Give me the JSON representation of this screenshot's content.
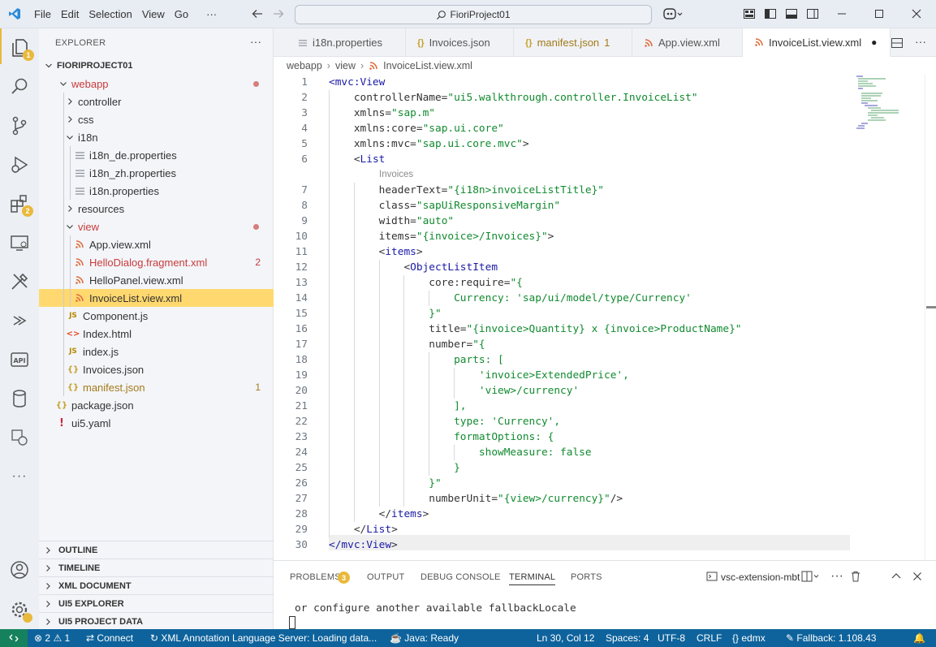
{
  "menu": [
    "File",
    "Edit",
    "Selection",
    "View",
    "Go",
    "···"
  ],
  "title": "FioriProject01",
  "explorer": {
    "header": "EXPLORER",
    "more": "···",
    "project": "FIORIPROJECT01",
    "tree": [
      {
        "label": "webapp",
        "type": "folder-open",
        "depth": 0,
        "style": "modified",
        "dot": true
      },
      {
        "label": "controller",
        "type": "folder",
        "depth": 1
      },
      {
        "label": "css",
        "type": "folder",
        "depth": 1
      },
      {
        "label": "i18n",
        "type": "folder-open",
        "depth": 1
      },
      {
        "label": "i18n_de.properties",
        "type": "settings",
        "depth": 2
      },
      {
        "label": "i18n_zh.properties",
        "type": "settings",
        "depth": 2
      },
      {
        "label": "i18n.properties",
        "type": "settings",
        "depth": 2
      },
      {
        "label": "resources",
        "type": "folder",
        "depth": 1
      },
      {
        "label": "view",
        "type": "folder-open",
        "depth": 1,
        "style": "modified",
        "dot": true
      },
      {
        "label": "App.view.xml",
        "type": "xml",
        "depth": 2
      },
      {
        "label": "HelloDialog.fragment.xml",
        "type": "xml",
        "depth": 2,
        "style": "error",
        "deco": "2"
      },
      {
        "label": "HelloPanel.view.xml",
        "type": "xml",
        "depth": 2
      },
      {
        "label": "InvoiceList.view.xml",
        "type": "xml",
        "depth": 2,
        "selected": true
      },
      {
        "label": "Component.js",
        "type": "js",
        "depth": 1
      },
      {
        "label": "Index.html",
        "type": "html",
        "depth": 1
      },
      {
        "label": "index.js",
        "type": "js",
        "depth": 1
      },
      {
        "label": "Invoices.json",
        "type": "json",
        "depth": 1
      },
      {
        "label": "manifest.json",
        "type": "json",
        "depth": 1,
        "style": "warn",
        "deco": "1"
      },
      {
        "label": "package.json",
        "type": "json",
        "depth": 0
      },
      {
        "label": "ui5.yaml",
        "type": "yaml",
        "depth": 0
      }
    ],
    "sections": [
      "OUTLINE",
      "TIMELINE",
      "XML DOCUMENT",
      "UI5 EXPLORER",
      "UI5 PROJECT DATA"
    ]
  },
  "activity_badges": {
    "explorer": "1",
    "extensions": "2"
  },
  "tabs": [
    {
      "label": "i18n.properties",
      "icon": "settings"
    },
    {
      "label": "Invoices.json",
      "icon": "json"
    },
    {
      "label": "manifest.json",
      "icon": "json",
      "deco": "1",
      "warn": true
    },
    {
      "label": "App.view.xml",
      "icon": "xml"
    },
    {
      "label": "InvoiceList.view.xml",
      "icon": "xml",
      "active": true,
      "dirty": "●"
    }
  ],
  "breadcrumb": [
    "webapp",
    "view",
    "InvoiceList.view.xml"
  ],
  "code": {
    "lines": [
      [
        [
          "tg",
          "<mvc:View"
        ]
      ],
      [
        [
          "at",
          "    controllerName="
        ],
        [
          "st",
          "\"ui5.walkthrough.controller.InvoiceList\""
        ]
      ],
      [
        [
          "at",
          "    xmlns="
        ],
        [
          "st",
          "\"sap.m\""
        ]
      ],
      [
        [
          "at",
          "    xmlns:core="
        ],
        [
          "st",
          "\"sap.ui.core\""
        ]
      ],
      [
        [
          "at",
          "    xmlns:mvc="
        ],
        [
          "st",
          "\"sap.ui.core.mvc\""
        ],
        [
          "at",
          ">"
        ]
      ],
      [
        [
          "at",
          "    <"
        ],
        [
          "tg",
          "List"
        ]
      ],
      [
        [
          "at",
          "        headerText="
        ],
        [
          "st",
          "\"{i18n>invoiceListTitle}\""
        ]
      ],
      [
        [
          "at",
          "        class="
        ],
        [
          "st",
          "\"sapUiResponsiveMargin\""
        ]
      ],
      [
        [
          "at",
          "        width="
        ],
        [
          "st",
          "\"auto\""
        ]
      ],
      [
        [
          "at",
          "        items="
        ],
        [
          "st",
          "\"{invoice>/Invoices}\""
        ],
        [
          "at",
          ">"
        ]
      ],
      [
        [
          "at",
          "        <"
        ],
        [
          "tg",
          "items"
        ],
        [
          "at",
          ">"
        ]
      ],
      [
        [
          "at",
          "            <"
        ],
        [
          "tg",
          "ObjectListItem"
        ]
      ],
      [
        [
          "at",
          "                core:require="
        ],
        [
          "st",
          "\"{"
        ]
      ],
      [
        [
          "st",
          "                    Currency: 'sap/ui/model/type/Currency'"
        ]
      ],
      [
        [
          "st",
          "                }\""
        ]
      ],
      [
        [
          "at",
          "                title="
        ],
        [
          "st",
          "\"{invoice>Quantity} x {invoice>ProductName}\""
        ]
      ],
      [
        [
          "at",
          "                number="
        ],
        [
          "st",
          "\"{"
        ]
      ],
      [
        [
          "st",
          "                    parts: ["
        ]
      ],
      [
        [
          "st",
          "                        'invoice>ExtendedPrice',"
        ]
      ],
      [
        [
          "st",
          "                        'view>/currency'"
        ]
      ],
      [
        [
          "st",
          "                    ],"
        ]
      ],
      [
        [
          "st",
          "                    type: 'Currency',"
        ]
      ],
      [
        [
          "st",
          "                    formatOptions: {"
        ]
      ],
      [
        [
          "st",
          "                        showMeasure: false"
        ]
      ],
      [
        [
          "st",
          "                    }"
        ]
      ],
      [
        [
          "st",
          "                }\""
        ]
      ],
      [
        [
          "at",
          "                numberUnit="
        ],
        [
          "st",
          "\"{view>/currency}\""
        ],
        [
          "at",
          "/>"
        ]
      ],
      [
        [
          "at",
          "        </"
        ],
        [
          "tg",
          "items"
        ],
        [
          "at",
          ">"
        ]
      ],
      [
        [
          "at",
          "    </"
        ],
        [
          "tg",
          "List"
        ],
        [
          "at",
          ">"
        ]
      ],
      [
        [
          "tg",
          "</mvc:View"
        ],
        [
          "at",
          ">"
        ]
      ]
    ],
    "inlay_hint": "Invoices"
  },
  "panel": {
    "tabs": [
      "PROBLEMS",
      "OUTPUT",
      "DEBUG CONSOLE",
      "TERMINAL",
      "PORTS"
    ],
    "problems_badge": "3",
    "terminal_name": "vsc-extension-mbt",
    "terminal_text": "or configure another available fallbackLocale"
  },
  "status": {
    "problems": "2",
    "warnings": "1",
    "connect": "Connect",
    "xml_server": "XML Annotation Language Server: Loading data...",
    "java": "Java: Ready",
    "position": "Ln 30, Col 12",
    "spaces": "Spaces: 4",
    "encoding": "UTF-8",
    "eol": "CRLF",
    "language": "edmx",
    "fallback": "Fallback: 1.108.43"
  },
  "colors": {
    "accent": "#0e639c",
    "remote": "#16825d",
    "selection": "#ffd970",
    "tag": "#1a1aa6",
    "string": "#118a2f"
  }
}
